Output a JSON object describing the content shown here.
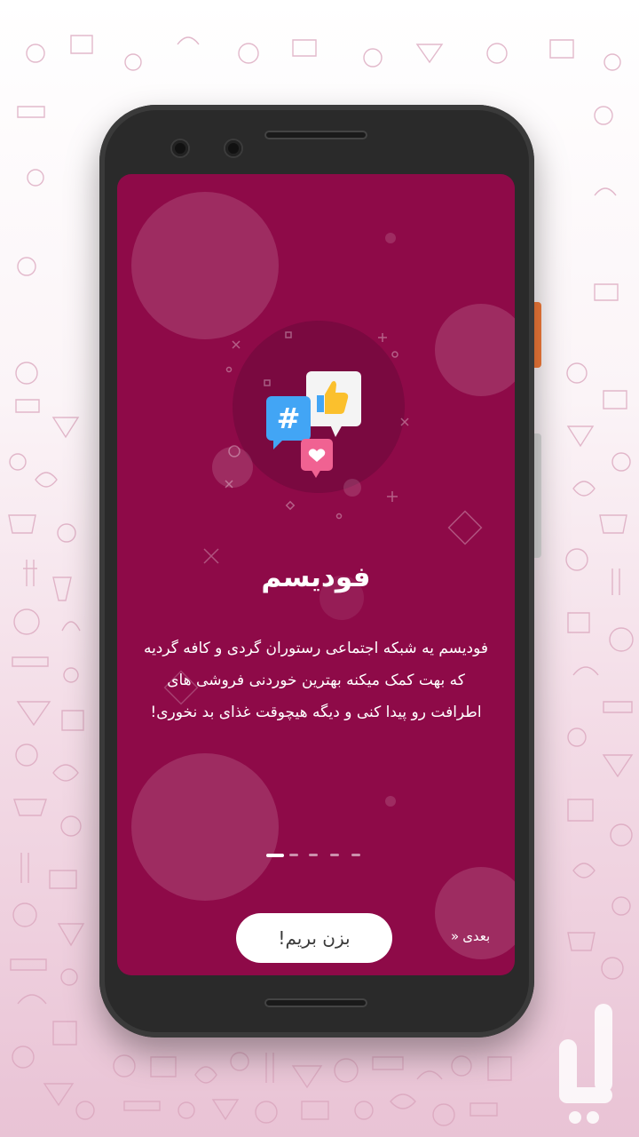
{
  "app": {
    "title": "فودیسم",
    "description_lines": [
      "فودیسم یه شبکه اجتماعی رستوران گردی و کافه گردیه",
      "که بهت کمک میکنه بهترین خوردنی فروشی های",
      "اطرافت رو پیدا کنی و دیگه هیچوقت غذای بد نخوری!"
    ]
  },
  "onboarding": {
    "start_button": "بزن بریم!",
    "next_label": "بعدی",
    "next_icon": "«",
    "page_dots": {
      "total": 5,
      "active_index": 0
    }
  },
  "illustration": {
    "hashtag_symbol": "#",
    "icons": [
      "hashtag-bubble-icon",
      "thumbs-up-bubble-icon",
      "heart-bubble-icon"
    ]
  },
  "colors": {
    "screen_bg": "#8e0a48",
    "accent_blue": "#42a5f5",
    "accent_pink": "#f06292",
    "accent_yellow": "#fbc02d",
    "phone_body": "#2a2a2a",
    "side_button": "#f47b3a"
  }
}
